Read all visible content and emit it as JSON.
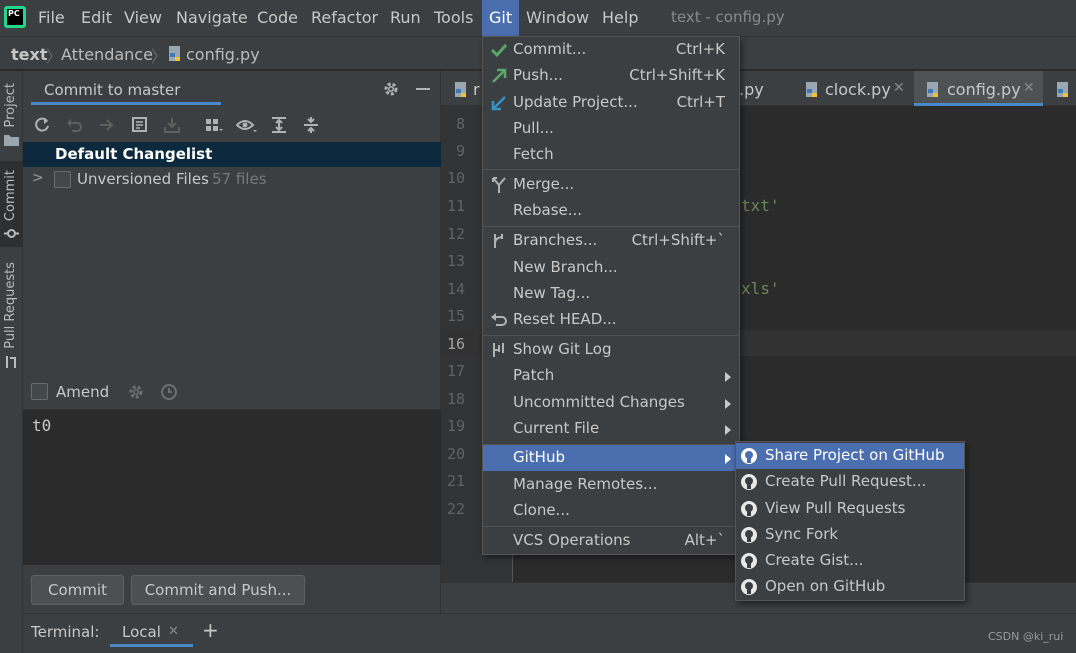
{
  "menubar": {
    "items": [
      "File",
      "Edit",
      "View",
      "Navigate",
      "Code",
      "Refactor",
      "Run",
      "Tools",
      "Git",
      "Window",
      "Help"
    ],
    "window_title": "text - config.py"
  },
  "breadcrumb": [
    "text",
    "Attendance",
    "config.py"
  ],
  "left_stripe": [
    "Project",
    "Commit",
    "Pull Requests"
  ],
  "commit_panel": {
    "title": "Commit to master",
    "changelist": "Default Changelist",
    "unversioned_label": "Unversioned Files",
    "unversioned_count": "57 files",
    "amend_label": "Amend",
    "message": "t0",
    "commit_button": "Commit",
    "commit_push_button": "Commit and Push..."
  },
  "editor": {
    "tabs": [
      {
        "label": "r"
      },
      {
        "label": ".py"
      },
      {
        "label": "clock.py"
      },
      {
        "label": "config.py"
      }
    ],
    "line_numbers": [
      "8",
      "9",
      "10",
      "11",
      "12",
      "13",
      "14",
      "15",
      "16",
      "17",
      "18",
      "19",
      "20",
      "21",
      "22"
    ],
    "code_fragments": [
      "txt'",
      "xls'"
    ]
  },
  "git_menu": {
    "items": [
      {
        "label": "Commit...",
        "shortcut": "Ctrl+K",
        "icon": "check-icon"
      },
      {
        "label": "Push...",
        "shortcut": "Ctrl+Shift+K",
        "icon": "push-arrow-icon"
      },
      {
        "label": "Update Project...",
        "shortcut": "Ctrl+T",
        "icon": "update-arrow-icon"
      },
      {
        "label": "Pull...",
        "shortcut": ""
      },
      {
        "label": "Fetch",
        "shortcut": ""
      },
      {
        "label": "Merge...",
        "shortcut": "",
        "icon": "merge-icon"
      },
      {
        "label": "Rebase...",
        "shortcut": ""
      },
      {
        "label": "Branches...",
        "shortcut": "Ctrl+Shift+`",
        "icon": "branch-icon"
      },
      {
        "label": "New Branch...",
        "shortcut": ""
      },
      {
        "label": "New Tag...",
        "shortcut": ""
      },
      {
        "label": "Reset HEAD...",
        "shortcut": "",
        "icon": "reset-icon"
      },
      {
        "label": "Show Git Log",
        "shortcut": "",
        "icon": "git-log-icon"
      },
      {
        "label": "Patch",
        "shortcut": ""
      },
      {
        "label": "Uncommitted Changes",
        "shortcut": ""
      },
      {
        "label": "Current File",
        "shortcut": ""
      },
      {
        "label": "GitHub",
        "shortcut": ""
      },
      {
        "label": "Manage Remotes...",
        "shortcut": ""
      },
      {
        "label": "Clone...",
        "shortcut": ""
      },
      {
        "label": "VCS Operations",
        "shortcut": "Alt+`"
      }
    ]
  },
  "github_submenu": {
    "items": [
      "Share Project on GitHub",
      "Create Pull Request...",
      "View Pull Requests",
      "Sync Fork",
      "Create Gist...",
      "Open on GitHub"
    ]
  },
  "terminal": {
    "label": "Terminal:",
    "tab": "Local",
    "add": "+"
  },
  "watermark": "CSDN @ki_rui",
  "colors": {
    "accent": "#4b6eaf",
    "underline": "#4a88c7",
    "selection_dark": "#0d293e",
    "check_green": "#59a869",
    "push_green": "#59a869",
    "update_blue": "#3592c4"
  }
}
